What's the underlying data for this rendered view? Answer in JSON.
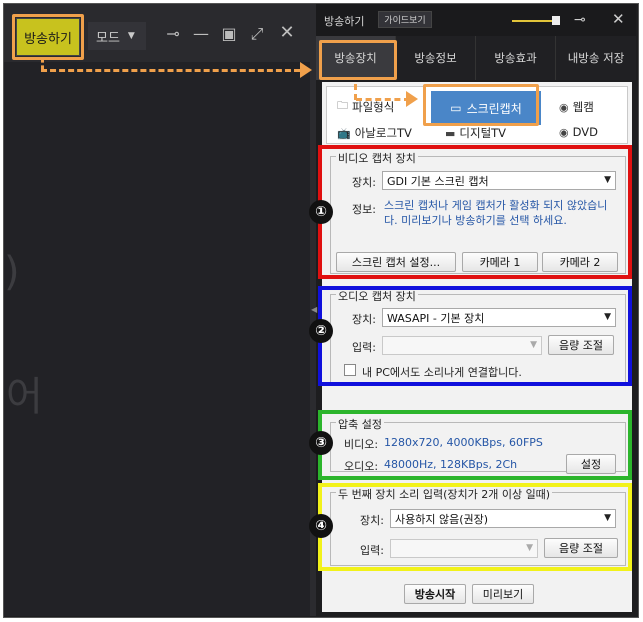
{
  "left": {
    "broadcast_label": "방송하기",
    "mode_label": "모드",
    "ghost_text_1": ")",
    "ghost_text_2": "어"
  },
  "titlebar": {
    "title": "방송하기",
    "guide_label": "가이드보기"
  },
  "tabs": [
    {
      "label": "방송장치",
      "active": true
    },
    {
      "label": "방송정보",
      "active": false
    },
    {
      "label": "방송효과",
      "active": false
    },
    {
      "label": "내방송 저장",
      "active": false
    }
  ],
  "sources": {
    "items": [
      {
        "label": "파일형식",
        "icon": "folder-icon"
      },
      {
        "label": "스크린캡처",
        "icon": "screen-capture-icon",
        "selected": true
      },
      {
        "label": "웹캠",
        "icon": "radio-icon"
      },
      {
        "label": "아날로그TV",
        "icon": "tv-icon"
      },
      {
        "label": "디지털TV",
        "icon": "monitor-icon"
      },
      {
        "label": "DVD",
        "icon": "radio-icon"
      }
    ]
  },
  "video_capture": {
    "title": "비디오 캡처 장치",
    "device_label": "장치:",
    "device_value": "GDI 기본 스크린 캡처",
    "info_label": "정보:",
    "info_text": "스크린 캡처나 게임 캡처가 활성화 되지 않았습니다. 미리보기나 방송하기를 선택 하세요.",
    "buttons": [
      "스크린 캡처 설정...",
      "카메라 1",
      "카메라 2"
    ]
  },
  "audio_capture": {
    "title": "오디오 캡처 장치",
    "device_label": "장치:",
    "device_value": "WASAPI - 기본 장치",
    "input_label": "입력:",
    "input_value": "",
    "volume_button": "음량 조절",
    "checkbox_label": "내 PC에서도 소리나게 연결합니다.",
    "checkbox_checked": false
  },
  "compression": {
    "title": "압축 설정",
    "video_label": "비디오:",
    "video_value": "1280x720, 4000KBps, 60FPS",
    "audio_label": "오디오:",
    "audio_value": "48000Hz, 128KBps, 2Ch",
    "settings_button": "설정"
  },
  "second_audio": {
    "title": "두 번째 장치 소리 입력(장치가 2개 이상 일때)",
    "device_label": "장치:",
    "device_value": "사용하지 않음(권장)",
    "input_label": "입력:",
    "input_value": "",
    "volume_button": "음량 조절"
  },
  "markers": [
    "①",
    "②",
    "③",
    "④"
  ],
  "bottom": {
    "start_label": "방송시작",
    "preview_label": "미리보기"
  },
  "colors": {
    "highlight_orange": "#f0a04b",
    "section_red": "#e01010",
    "section_blue": "#1010dd",
    "section_green": "#2cb52c",
    "section_yellow": "#f2f21a",
    "selected_blue": "#4a86c8",
    "info_text": "#2556a6"
  }
}
